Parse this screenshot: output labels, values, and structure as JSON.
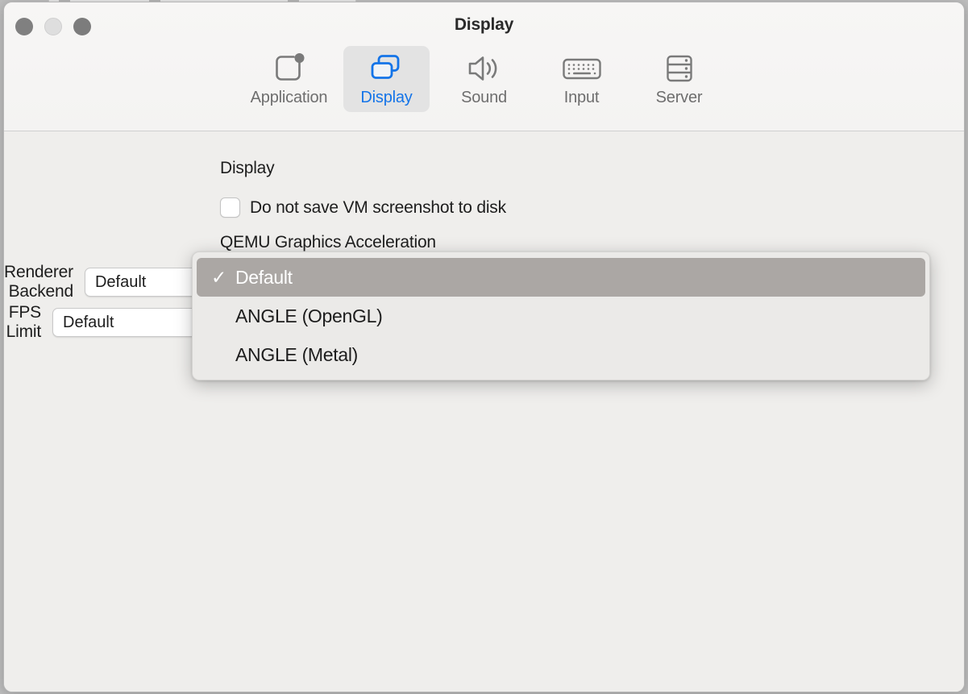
{
  "window": {
    "title": "Display",
    "traffic_lights": [
      {
        "name": "close",
        "color": "#808080"
      },
      {
        "name": "minimize",
        "color": "#dedede"
      },
      {
        "name": "maximize",
        "color": "#7c7c7c"
      }
    ]
  },
  "toolbar": {
    "items": [
      {
        "label": "Application",
        "icon": "application-icon",
        "selected": false
      },
      {
        "label": "Display",
        "icon": "display-icon",
        "selected": true
      },
      {
        "label": "Sound",
        "icon": "sound-icon",
        "selected": false
      },
      {
        "label": "Input",
        "icon": "keyboard-icon",
        "selected": false
      },
      {
        "label": "Server",
        "icon": "server-icon",
        "selected": false
      }
    ],
    "selected_color": "#1474e8",
    "unselected_color": "#6e6e6e"
  },
  "content": {
    "section_header": "Display",
    "checkbox": {
      "label": "Do not save VM screenshot to disk",
      "checked": false
    },
    "accel_header": "QEMU Graphics Acceleration",
    "renderer_backend": {
      "label": "Renderer Backend",
      "value": "Default"
    },
    "fps_limit": {
      "label": "FPS Limit",
      "value": "Default"
    }
  },
  "dropdown": {
    "open": true,
    "highlight_color": "#aba7a4",
    "selected_index": 0,
    "check_glyph": "✓",
    "items": [
      {
        "label": "Default",
        "checked": true,
        "highlighted": true
      },
      {
        "label": "ANGLE (OpenGL)",
        "checked": false,
        "highlighted": false
      },
      {
        "label": "ANGLE (Metal)",
        "checked": false,
        "highlighted": false
      }
    ]
  }
}
